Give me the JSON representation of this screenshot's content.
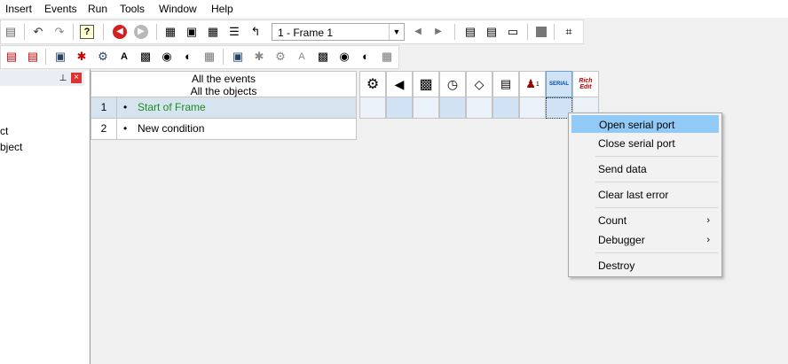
{
  "menubar": {
    "items": [
      "Insert",
      "Events",
      "Run",
      "Tools",
      "Window",
      "Help"
    ]
  },
  "toolbar": {
    "frame_select": "1 - Frame 1"
  },
  "left_pane": {
    "lines": [
      "ct",
      "bject"
    ]
  },
  "event_grid": {
    "header_line1": "All the events",
    "header_line2": "All the objects",
    "rows": [
      {
        "num": "1",
        "bullet": "•",
        "text": "Start of Frame",
        "color": "#1e8c1e"
      },
      {
        "num": "2",
        "bullet": "•",
        "text": "New condition",
        "color": "#000000"
      }
    ],
    "object_badges": {
      "serial": "SERIAL",
      "richedit_1": "Rich",
      "richedit_2": "Edit",
      "counter_sup": "1"
    }
  },
  "context_menu": {
    "items": [
      {
        "label": "Open serial port",
        "highlighted": true
      },
      {
        "label": "Close serial port"
      },
      {
        "label": "Send data"
      },
      {
        "label": "Clear last error"
      },
      {
        "label": "Count",
        "submenu": true
      },
      {
        "label": "Debugger",
        "submenu": true
      },
      {
        "label": "Destroy"
      }
    ],
    "submenu_arrow": "›"
  },
  "colors": {
    "selected_row": "#d6e4f0",
    "cell_selected": "#d0e2f4",
    "highlight": "#91c9f7"
  }
}
